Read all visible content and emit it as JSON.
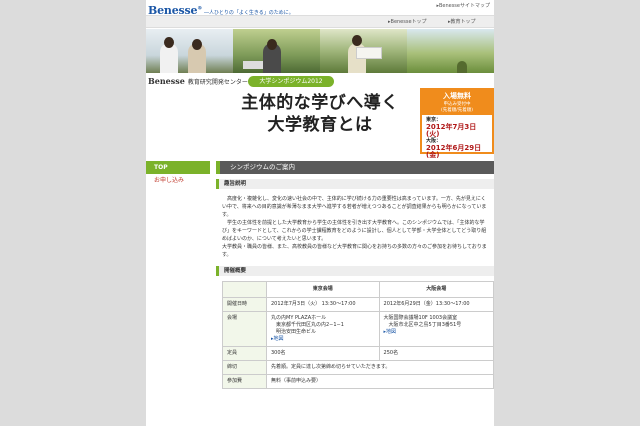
{
  "header": {
    "logo": "Benesse",
    "tagline": "―人ひとりの「よく生きる」のために。",
    "sitemap": "▸Benesseサイトマップ",
    "nav": [
      "▸Benesseトップ",
      "▸教育トップ"
    ]
  },
  "brand": {
    "name": "Benesse",
    "center": "教育研究開発センター",
    "badge": "大学シンポジウム2012"
  },
  "headline": {
    "line1": "主体的な学びへ導く",
    "line2": "大学教育とは"
  },
  "info": {
    "title": "入場無料",
    "sub1": "申込み受付中",
    "sub2": "(先着順/先着順)",
    "tokyo_label": "東京：",
    "tokyo_date": "2012年7月3日(火)",
    "osaka_label": "大阪：",
    "osaka_date": "2012年6月29日(金)"
  },
  "sidebar": {
    "top": "TOP",
    "link": "お申し込み"
  },
  "main": {
    "section_title": "シンポジウムのご案内",
    "purpose_title": "趣旨説明",
    "paragraphs": [
      "高度化・複雑化し、変化の速い社会の中で、主体的に学び続ける力の重要性は高まっています。一方、先が見えにくい中で、将来への目的意識が希薄なまま大学へ進学する若者が増えつつあることが調査結果からも明らかになっています。",
      "学生の主体性を前提とした大学教育から学生の主体性を引き出す大学教育へ。このシンポジウムでは、「主体的な学び」をキーワードとして、これからの学士課程教育をどのように設計し、個人として学部・大学全体としてどう取り組めばよいのか、について考えたいと思います。",
      "大学教員・職員の皆様、また、高校教員の皆様など大学教育に関心をお持ちの多数の方々のご参加をお待ちしております。"
    ],
    "overview_title": "開催概要",
    "table": {
      "col_tokyo": "東京会場",
      "col_osaka": "大阪会場",
      "rows": [
        {
          "label": "開催日時",
          "tokyo": "2012年7月3日（火） 13:30～17:00",
          "osaka": "2012年6月29日（金）13:30～17:00"
        },
        {
          "label": "会場",
          "tokyo": "丸の内MY PLAZAホール\n　東京都千代田区丸の内2−1−1\n　明治安田生命ビル",
          "tokyo_map": "▸地図",
          "osaka": "大阪国際会議場10F 1003会議室\n　大阪市北区中之島5丁目3番51号",
          "osaka_map": "▸地図"
        },
        {
          "label": "定員",
          "tokyo": "300名",
          "osaka": "250名"
        },
        {
          "label": "締切",
          "tokyo": "先着順。定員に達し次第締め切らせていただきます。",
          "osaka": ""
        },
        {
          "label": "参加費",
          "tokyo": "無料（事前申込み要）",
          "osaka": ""
        }
      ]
    }
  }
}
